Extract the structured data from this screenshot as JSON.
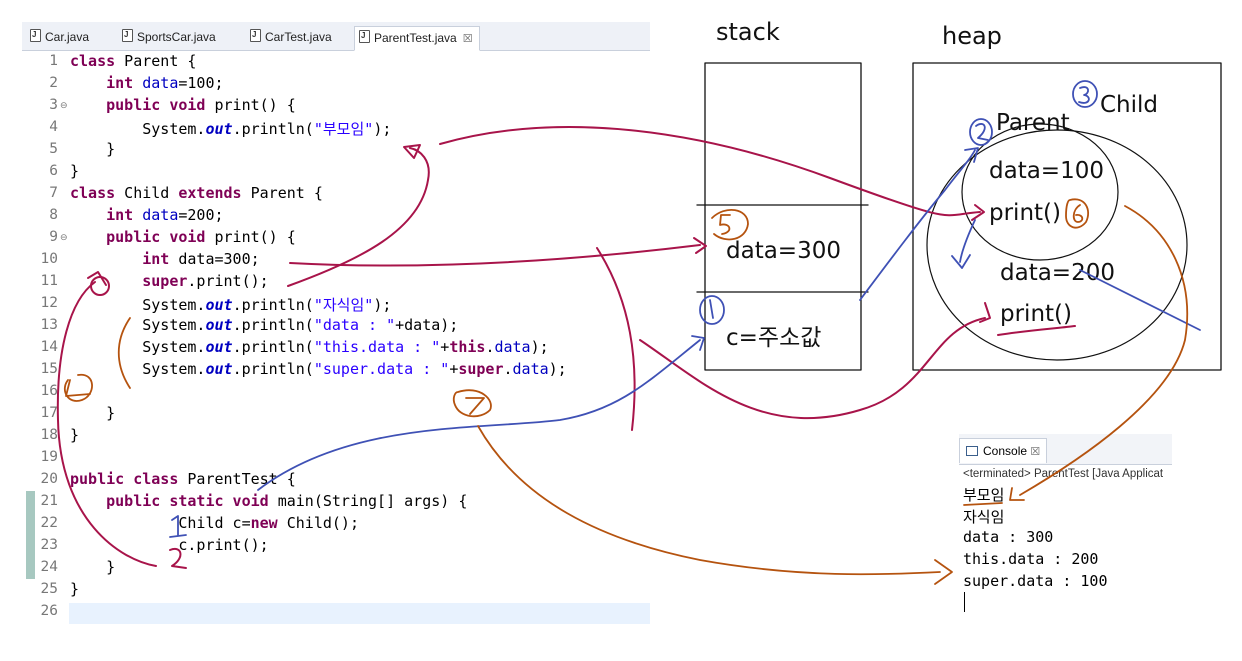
{
  "editor": {
    "tabs": [
      {
        "label": "Car.java"
      },
      {
        "label": "SportsCar.java"
      },
      {
        "label": "CarTest.java"
      },
      {
        "label": "ParentTest.java",
        "active": true,
        "close": "☒"
      }
    ],
    "line_numbers": [
      "1",
      "2",
      "3",
      "4",
      "5",
      "6",
      "7",
      "8",
      "9",
      "10",
      "11",
      "12",
      "13",
      "14",
      "15",
      "16",
      "17",
      "18",
      "19",
      "20",
      "21",
      "22",
      "23",
      "24",
      "25",
      "26"
    ],
    "code": {
      "l1": {
        "kw": "class",
        "rest": " Parent {"
      },
      "l2": {
        "kw": "int",
        "field": "data",
        "rest": "=100;"
      },
      "l3": {
        "kw": "public void",
        "rest": " print() {"
      },
      "l4": {
        "a": "System.",
        "out": "out",
        "b": ".println(",
        "str": "\"부모임\"",
        "c": ");"
      },
      "l5": "}",
      "l6": "}",
      "l7": {
        "kw": "class",
        "mid": " Child ",
        "kw2": "extends",
        "rest": " Parent {"
      },
      "l8": {
        "kw": "int",
        "field": "data",
        "rest": "=200;"
      },
      "l9": {
        "kw": "public void",
        "rest": " print() {"
      },
      "l10": {
        "kw": "int",
        "rest": " data=300;"
      },
      "l11": {
        "kw": "super",
        "rest": ".print();"
      },
      "l12": {
        "a": "System.",
        "out": "out",
        "b": ".println(",
        "str": "\"자식임\"",
        "c": ");"
      },
      "l13": {
        "a": "System.",
        "out": "out",
        "b": ".println(",
        "str": "\"data : \"",
        "c": "+data);"
      },
      "l14": {
        "a": "System.",
        "out": "out",
        "b": ".println(",
        "str": "\"this.data : \"",
        "plus": "+",
        "kw": "this",
        "dot": ".",
        "field": "data",
        "c": ");"
      },
      "l15": {
        "a": "System.",
        "out": "out",
        "b": ".println(",
        "str": "\"super.data : \"",
        "plus": "+",
        "kw": "super",
        "dot": ".",
        "field": "data",
        "c": ");"
      },
      "l17": "}",
      "l18": "}",
      "l20": {
        "kw": "public class",
        "rest": " ParentTest {"
      },
      "l21": {
        "kw": "public static void",
        "rest": " main(String[] args) {"
      },
      "l22": {
        "a": "Child c=",
        "kw": "new",
        "rest": " Child();"
      },
      "l23": "c.print();",
      "l24": "}",
      "l25": "}"
    }
  },
  "diagram": {
    "stack_label": "stack",
    "heap_label": "heap",
    "stack_cells": {
      "local": "data=300",
      "ref": "c=주소값"
    },
    "heap": {
      "child_label": "Child",
      "parent_label": "Parent",
      "parent_data": "data=100",
      "parent_print": "print()",
      "child_data": "data=200",
      "child_print": "print()"
    },
    "annotation_numbers": [
      "1",
      "2",
      "3",
      "4",
      "5",
      "6",
      "7",
      "1",
      "2"
    ]
  },
  "console": {
    "tab_label": "Console",
    "close": "☒",
    "status": "<terminated> ParentTest [Java Applicat",
    "output": [
      "부모임",
      "자식임",
      "data : 300",
      "this.data : 200",
      "super.data : 100"
    ]
  },
  "colors": {
    "keyword": "#7f0055",
    "field": "#0000c0",
    "string": "#2a00ff",
    "ink_red": "#a8144a",
    "ink_blue": "#3f51b5",
    "ink_orange": "#b5530f"
  }
}
